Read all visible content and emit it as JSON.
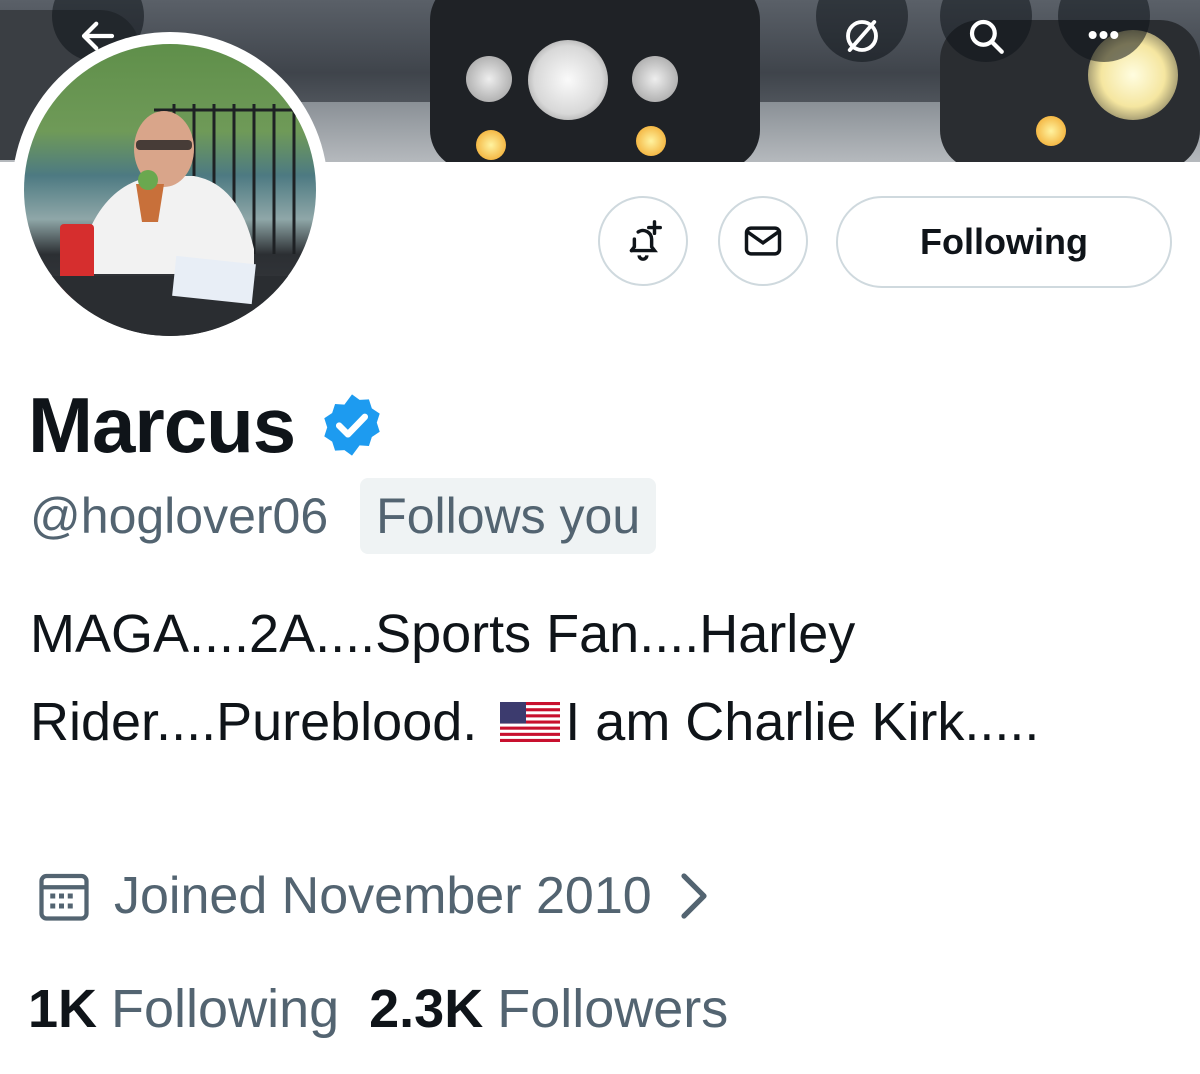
{
  "header": {
    "back_icon": "arrow-left-icon",
    "grok_icon": "slash-circle-icon",
    "search_icon": "search-icon",
    "more_label": "•••"
  },
  "actions": {
    "notify_icon": "bell-plus-icon",
    "message_icon": "envelope-icon",
    "following_label": "Following"
  },
  "profile": {
    "name": "Marcus",
    "handle": "@hoglover06",
    "follows_you": "Follows you",
    "bio_part1": "MAGA....2A....Sports Fan....Harley Rider....Pureblood.",
    "bio_part2": "I am Charlie Kirk.....",
    "joined": "Joined November 2010",
    "following_count": "1K",
    "following_label": "Following",
    "followers_count": "2.3K",
    "followers_label": "Followers"
  },
  "colors": {
    "verified": "#1d9bf0",
    "secondary_text": "#536471",
    "border": "#cfd9de"
  }
}
